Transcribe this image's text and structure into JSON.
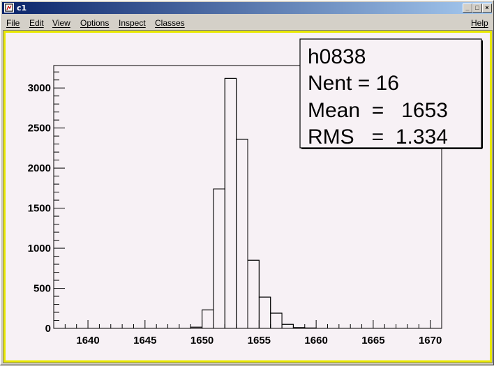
{
  "window": {
    "title": "c1",
    "controls": [
      "_",
      "□",
      "×"
    ]
  },
  "menu": {
    "file": "File",
    "edit": "Edit",
    "view": "View",
    "options": "Options",
    "inspect": "Inspect",
    "classes": "Classes",
    "help": "Help"
  },
  "stats": {
    "name": "h0838",
    "nent": "Nent = 16",
    "mean": "Mean  =   1653",
    "rms": "RMS   =  1.334"
  },
  "chart_data": {
    "type": "histogram",
    "title": "",
    "xlabel": "",
    "ylabel": "",
    "xlim": [
      1637,
      1671
    ],
    "ylim": [
      0,
      3280
    ],
    "x_ticks": [
      1640,
      1645,
      1650,
      1655,
      1660,
      1665,
      1670
    ],
    "y_ticks": [
      0,
      500,
      1000,
      1500,
      2000,
      2500,
      3000
    ],
    "bin_edges": [
      1649,
      1650,
      1651,
      1652,
      1653,
      1654,
      1655,
      1656,
      1657,
      1658,
      1659,
      1660
    ],
    "values": [
      15,
      230,
      1740,
      3120,
      2360,
      850,
      390,
      190,
      50,
      10,
      5
    ]
  }
}
